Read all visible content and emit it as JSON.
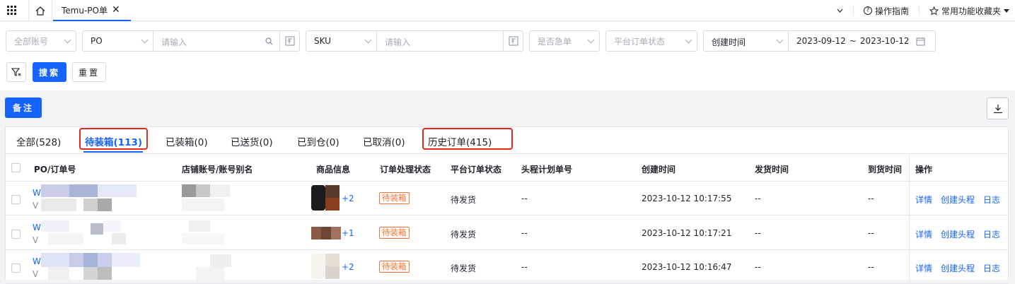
{
  "topbar": {
    "tab_label": "Temu-PO单",
    "close_glyph": "✕",
    "guide_label": "操作指南",
    "favorites_label": "常用功能收藏夹"
  },
  "filters": {
    "account_placeholder": "全部账号",
    "po_type": "PO",
    "po_placeholder": "请输入",
    "sku_type": "SKU",
    "sku_placeholder": "请输入",
    "urgent_placeholder": "是否急单",
    "platform_status_placeholder": "平台订单状态",
    "time_type": "创建时间",
    "date_start": "2023-09-12",
    "date_tilde": "~",
    "date_end": "2023-10-12",
    "search_label": "搜索",
    "reset_label": "重置"
  },
  "toolbar": {
    "note_label": "备注"
  },
  "tabs": [
    {
      "label": "全部(528)"
    },
    {
      "label": "待装箱(113)"
    },
    {
      "label": "已装箱(0)"
    },
    {
      "label": "已送货(0)"
    },
    {
      "label": "已到仓(0)"
    },
    {
      "label": "已取消(0)"
    },
    {
      "label": "历史订单(415)"
    }
  ],
  "table": {
    "headers": [
      "PO/订单号",
      "店铺账号/账号别名",
      "商品信息",
      "订单处理状态",
      "平台订单状态",
      "头程计划单号",
      "创建时间",
      "发货时间",
      "到货时间",
      "操作"
    ],
    "rows": [
      {
        "po_prefix": "W",
        "po_sub": "V",
        "extra_count": "+2",
        "status": "待装箱",
        "platform_status": "待发货",
        "plan_no": "--",
        "created": "2023-10-12 10:17:55",
        "shipped": "--",
        "arrived": "--"
      },
      {
        "po_prefix": "W",
        "po_sub": "V",
        "extra_count": "+1",
        "status": "待装箱",
        "platform_status": "待发货",
        "plan_no": "--",
        "created": "2023-10-12 10:17:21",
        "shipped": "--",
        "arrived": "--"
      },
      {
        "po_prefix": "W",
        "po_sub": "V",
        "extra_count": "+2",
        "status": "待装箱",
        "platform_status": "待发货",
        "plan_no": "--",
        "created": "2023-10-12 10:16:47",
        "shipped": "--",
        "arrived": "--"
      }
    ],
    "ops": {
      "detail": "详情",
      "create_plan": "创建头程",
      "log": "日志"
    }
  },
  "colors": {
    "primary": "#1664ff",
    "highlight": "#e8271e",
    "badge": "#f77234"
  }
}
